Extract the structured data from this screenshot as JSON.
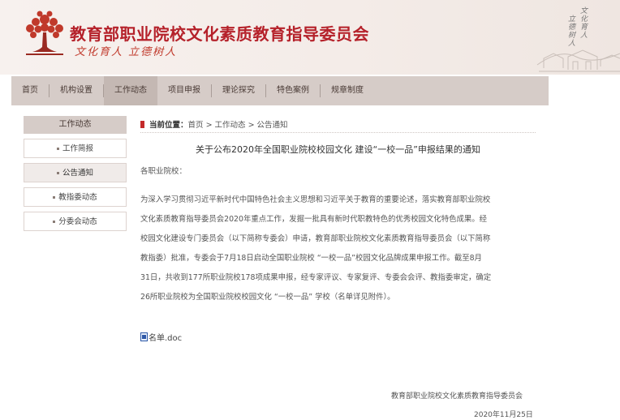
{
  "header": {
    "title": "教育部职业院校文化素质教育指导委员会",
    "slogan": "文化育人 立德树人",
    "calligraphy": [
      "文化育人",
      "立德树人"
    ],
    "brand_color": "#b5212a"
  },
  "nav": {
    "items": [
      {
        "label": "首页",
        "active": false
      },
      {
        "label": "机构设置",
        "active": false
      },
      {
        "label": "工作动态",
        "active": true
      },
      {
        "label": "项目申报",
        "active": false
      },
      {
        "label": "理论探究",
        "active": false
      },
      {
        "label": "特色案例",
        "active": false
      },
      {
        "label": "规章制度",
        "active": false
      }
    ]
  },
  "sidebar": {
    "title": "工作动态",
    "items": [
      {
        "label": "工作简报",
        "active": false
      },
      {
        "label": "公告通知",
        "active": true
      },
      {
        "label": "教指委动态",
        "active": false
      },
      {
        "label": "分委会动态",
        "active": false
      }
    ]
  },
  "breadcrumb": {
    "prefix": "当前位置：",
    "items": [
      "首页",
      "> 工作动态",
      "> 公告通知"
    ]
  },
  "article": {
    "title": "关于公布2020年全国职业院校校园文化 建设“一校一品”申报结果的通知",
    "salutation": "各职业院校：",
    "lines": [
      "为深入学习贯彻习近平新时代中国特色社会主义思想和习近平关于教育的重要论述，落实教育部职业院校",
      "文化素质教育指导委员会2020年重点工作，发掘一批具有新时代职教特色的优秀校园文化特色成果。经",
      "校园文化建设专门委员会（以下简称专委会）申请，教育部职业院校文化素质教育指导委员会（以下简称",
      "教指委）批准，专委会于7月18日启动全国职业院校 “一校一品”校园文化品牌成果申报工作。截至8月",
      "31日，共收到177所职业院校178项成果申报，经专家评议、专家复评、专委会会评、教指委审定，确定",
      "26所职业院校为全国职业院校校园文化 “一校一品” 学校（名单详见附件）。"
    ],
    "attachment": {
      "label": "名单.doc",
      "icon": "doc-file-icon"
    },
    "signature_org": "教育部职业院校文化素质教育指导委员会",
    "signature_date": "2020年11月25日"
  }
}
